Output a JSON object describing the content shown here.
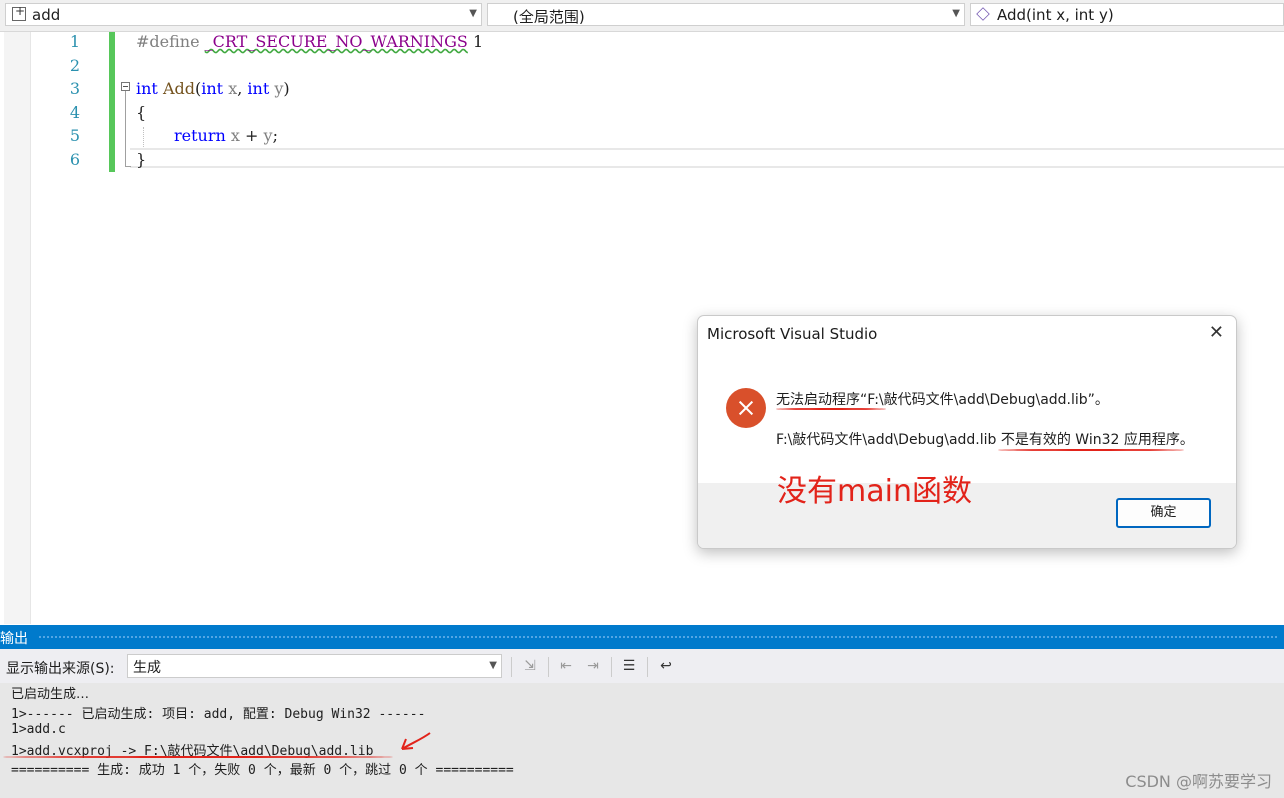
{
  "nav": {
    "project": "add",
    "scope": "(全局范围)",
    "member": "Add(int x, int y)"
  },
  "editor": {
    "line_numbers": [
      "1",
      "2",
      "3",
      "4",
      "5",
      "6"
    ],
    "code": {
      "l1_directive": "#define",
      "l1_macro": "_CRT_SECURE_NO_WARNINGS",
      "l1_value": "1",
      "l3_int1": "int",
      "l3_fn": "Add",
      "l3_open": "(",
      "l3_int2": "int",
      "l3_x": "x",
      "l3_comma": ",",
      "l3_int3": "int",
      "l3_y": "y",
      "l3_close": ")",
      "l4": "{",
      "l5_return": "return",
      "l5_expr_x": "x",
      "l5_plus": "+",
      "l5_expr_y": "y",
      "l5_semi": ";",
      "l6": "}"
    }
  },
  "dialog": {
    "title": "Microsoft Visual Studio",
    "close": "✕",
    "message1": "无法启动程序“F:\\敲代码文件\\add\\Debug\\add.lib”。",
    "message2": "F:\\敲代码文件\\add\\Debug\\add.lib 不是有效的 Win32 应用程序。",
    "annotation": "没有main函数",
    "ok_label": "确定"
  },
  "output": {
    "title": "输出",
    "source_label": "显示输出来源(S):",
    "source_value": "生成",
    "lines": [
      "已启动生成…",
      "1>------ 已启动生成: 项目: add, 配置: Debug Win32 ------",
      "1>add.c",
      "1>add.vcxproj -> F:\\敲代码文件\\add\\Debug\\add.lib",
      "========== 生成: 成功 1 个，失败 0 个，最新 0 个，跳过 0 个 =========="
    ]
  },
  "watermark": "CSDN @啊苏要学习",
  "colors": {
    "accent": "#007acc",
    "annotation_red": "#e2231a",
    "error_icon": "#d9502b",
    "change_bar": "#57c75a",
    "keyword": "#0000ff",
    "line_number": "#2b91af"
  }
}
